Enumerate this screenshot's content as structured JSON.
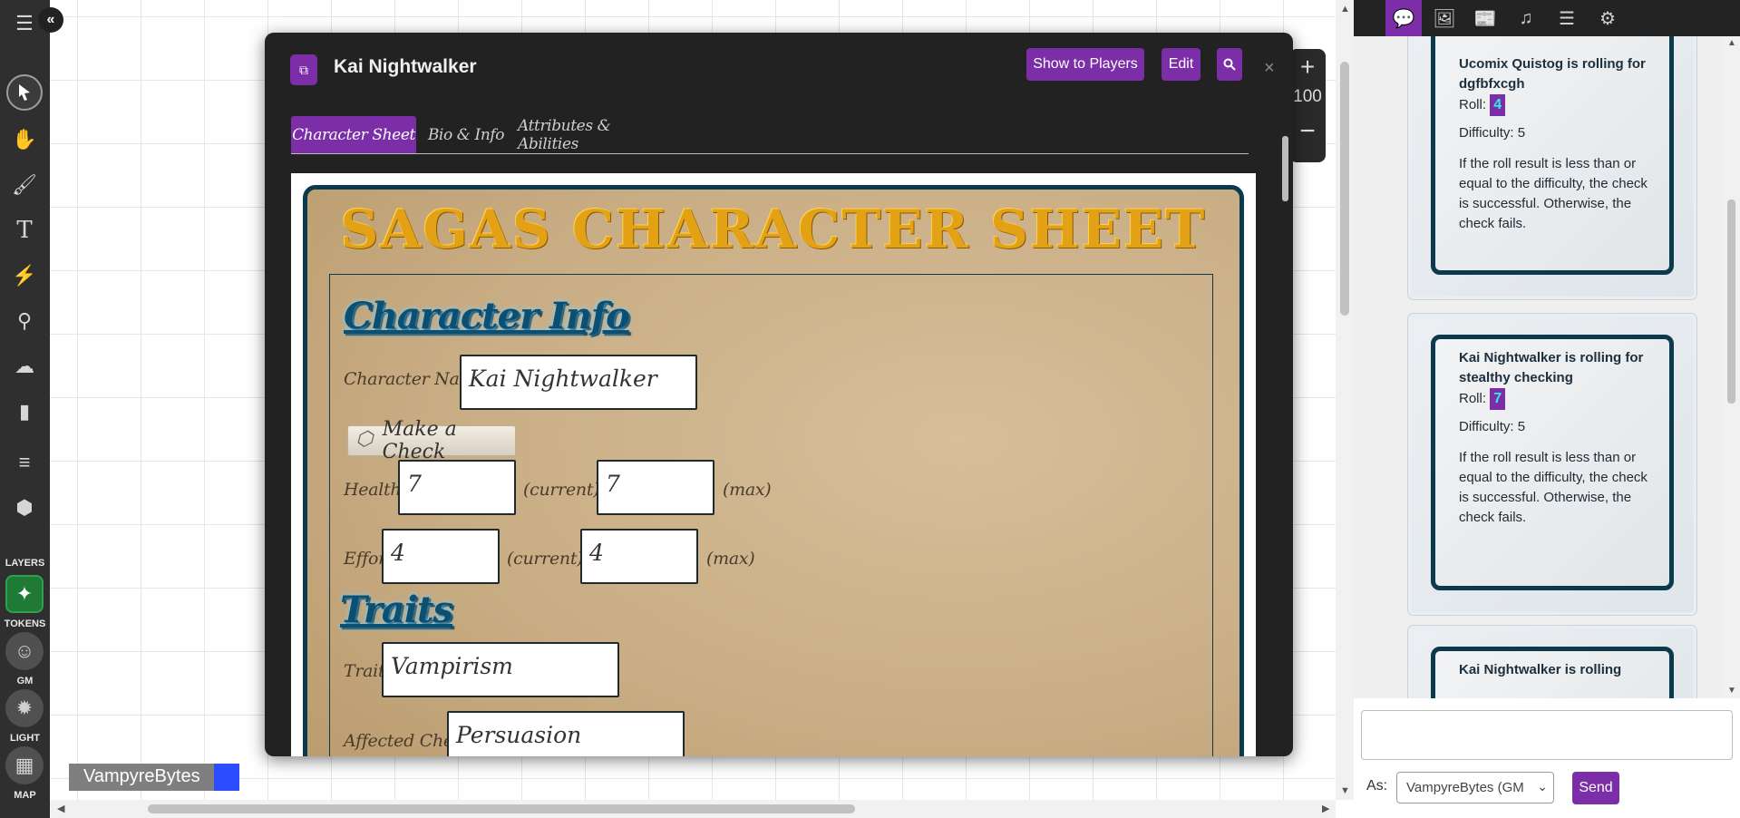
{
  "toolbar": {
    "layers_label": "LAYERS",
    "tokens_label": "TOKENS",
    "gm_label": "GM",
    "light_label": "LIGHT",
    "map_label": "MAP"
  },
  "canvas": {
    "player_name": "VampyreBytes",
    "zoom_value": "100"
  },
  "dialog": {
    "title": "Kai Nightwalker",
    "show_to_players": "Show to Players",
    "edit": "Edit",
    "close": "×",
    "tabs": [
      "Character Sheet",
      "Bio & Info",
      "Attributes & Abilities"
    ],
    "active_tab": 0
  },
  "sheet": {
    "title": "SAGAS CHARACTER SHEET",
    "character_info_heading": "Character Info",
    "character_name_label": "Character Name:",
    "character_name_value": "Kai Nightwalker",
    "make_check_button": "Make a Check",
    "health_label": "Health:",
    "health_current": "7",
    "health_max": "7",
    "effort_label": "Effort:",
    "effort_current": "4",
    "effort_max": "4",
    "current_sep": "(current) /",
    "max_label": "(max)",
    "traits_heading": "Traits",
    "trait_label": "Trait:",
    "trait_value": "Vampirism",
    "affected_check_label": "Affected Check:",
    "affected_check_value": "Persuasion"
  },
  "chat": {
    "messages": [
      {
        "who": "Ucomix Quistog is rolling for dgfbfxcgh",
        "roll_label": "Roll:",
        "roll": "4",
        "difficulty": "Difficulty: 5",
        "rule": "If the roll result is less than or equal to the difficulty, the check is successful. Otherwise, the check fails."
      },
      {
        "who": "Kai Nightwalker is rolling for stealthy checking",
        "roll_label": "Roll:",
        "roll": "7",
        "difficulty": "Difficulty: 5",
        "rule": "If the roll result is less than or equal to the difficulty, the check is successful. Otherwise, the check fails."
      },
      {
        "who": "Kai Nightwalker is rolling"
      }
    ],
    "as_label": "As:",
    "as_value": "VampyreBytes (GM",
    "send": "Send"
  },
  "colors": {
    "accent": "#7b2ea8",
    "toolbar_bg": "#2f2f2f",
    "dialog_bg": "#222222",
    "sheet_border": "#0b3a4f",
    "title_gold": "#e3a116",
    "tokens_layer": "#1f7a36"
  },
  "icons": {
    "toolbar": [
      "menu-icon",
      "select-pointer-icon",
      "pan-hand-icon",
      "draw-brush-icon",
      "text-icon",
      "fx-lightning-icon",
      "measure-icon",
      "fog-cloud-icon",
      "ruler-icon",
      "notes-icon",
      "dice-icon",
      "tokens-layer-icon",
      "gm-layer-icon",
      "light-layer-icon",
      "map-layer-icon"
    ],
    "chat_tabs": [
      "chat-bubble-icon",
      "art-library-icon",
      "journal-icon",
      "jukebox-icon",
      "collections-icon",
      "settings-gear-icon"
    ]
  }
}
